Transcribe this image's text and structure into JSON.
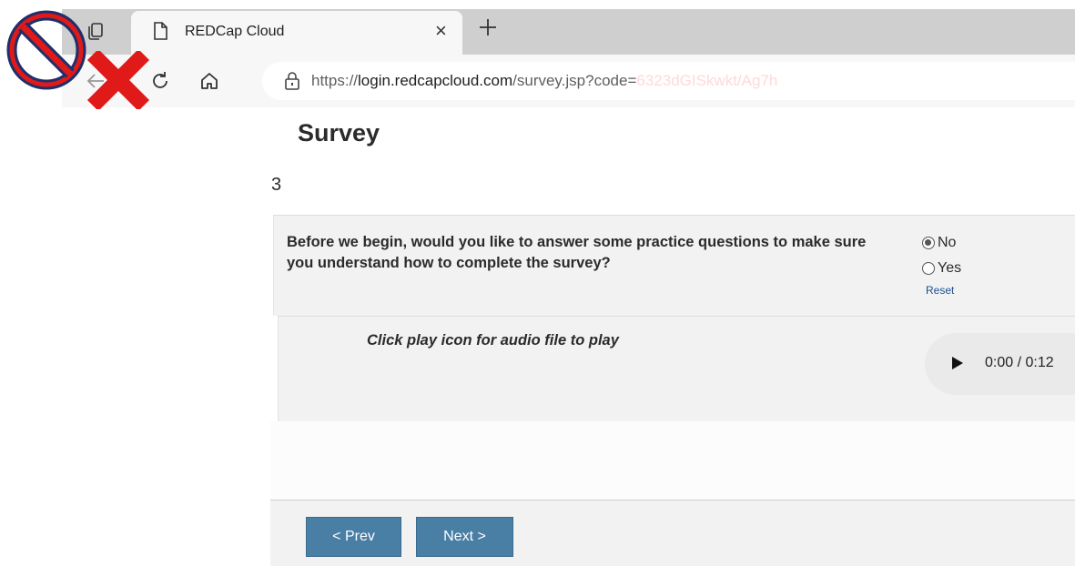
{
  "browser": {
    "tab_title": "REDCap Cloud",
    "url_prefix": "https://",
    "url_host": "login.redcapcloud.com",
    "url_path": "/survey.jsp?code=",
    "url_redacted": "6323dGISkwkt/Ag7h"
  },
  "overlay_icons": [
    "prohibited-icon",
    "red-x-icon"
  ],
  "survey": {
    "title": "Survey",
    "number": "3",
    "question": "Before we begin, would you like to answer some practice questions to make sure you understand how to complete the survey?",
    "options": [
      {
        "label": "No",
        "checked": true
      },
      {
        "label": "Yes",
        "checked": false
      }
    ],
    "reset_label": "Reset",
    "audio_instruction": "Click play icon for audio file to play",
    "audio_time": "0:00 / 0:12"
  },
  "footer": {
    "prev_label": "< Prev",
    "next_label": "Next >"
  },
  "colors": {
    "button_bg": "#4a7fa5",
    "block_bg": "#f2f2f2",
    "overlay_red": "#e01919",
    "prohibit_navy": "#1f2f6b"
  }
}
